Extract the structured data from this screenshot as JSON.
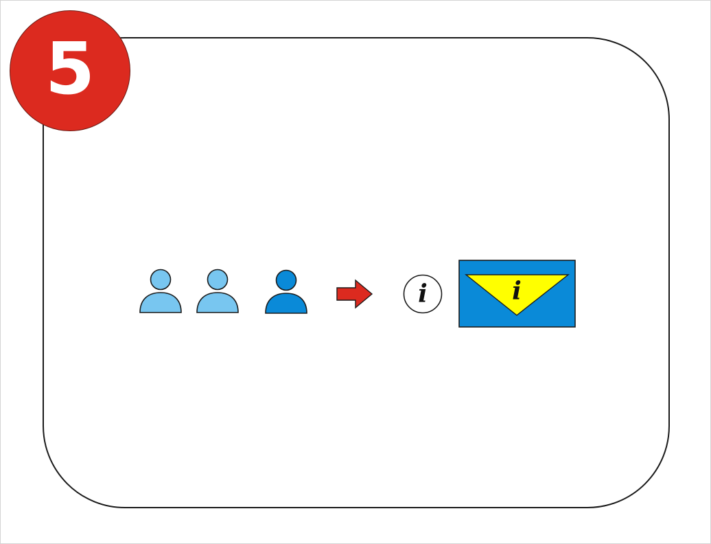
{
  "step": {
    "number": "5",
    "color": "#dc2a1f"
  },
  "icons": {
    "persons": [
      {
        "name": "person-icon",
        "state": "inactive",
        "color": "#78c6f0"
      },
      {
        "name": "person-icon",
        "state": "inactive",
        "color": "#78c6f0"
      },
      {
        "name": "person-icon",
        "state": "active",
        "color": "#0a8ad8"
      }
    ],
    "arrow": {
      "name": "arrow-right-icon",
      "color": "#dc2a1f"
    },
    "info_circle": {
      "name": "info-icon",
      "glyph": "i",
      "fill": "#ffffff"
    },
    "info_sign": {
      "name": "info-sign-icon",
      "glyph": "i",
      "background": "#0a8ad8",
      "triangle": "#ffff00"
    }
  }
}
